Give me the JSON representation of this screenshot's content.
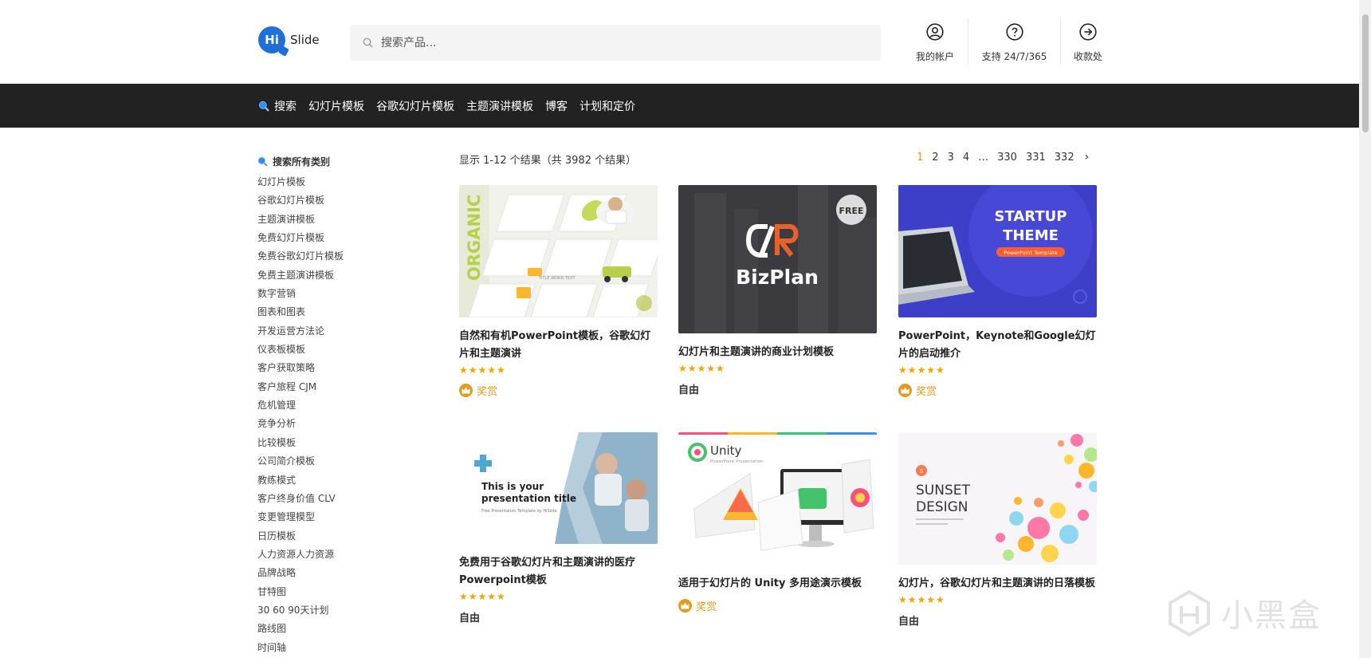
{
  "header": {
    "logo_mark": "Hi",
    "logo_text": "Slide",
    "search_placeholder": "搜索产品...",
    "actions": [
      {
        "label": "我的帐户",
        "icon": "user-circle-icon"
      },
      {
        "label": "支持 24/7/365",
        "icon": "help-circle-icon"
      },
      {
        "label": "收款处",
        "icon": "arrow-circle-right-icon"
      }
    ]
  },
  "nav": {
    "items": [
      "搜索",
      "幻灯片模板",
      "谷歌幻灯片模板",
      "主题演讲模板",
      "博客",
      "计划和定价"
    ]
  },
  "sidebar": {
    "heading": "搜索所有类别",
    "categories": [
      "幻灯片模板",
      "谷歌幻灯片模板",
      "主题演讲模板",
      "免费幻灯片模板",
      "免费谷歌幻灯片模板",
      "免费主题演讲模板",
      "数字营销",
      "图表和图表",
      "开发运营方法论",
      "仪表板模板",
      "客户获取策略",
      "客户旅程 CJM",
      "危机管理",
      "竞争分析",
      "比较模板",
      "公司简介模板",
      "教练模式",
      "客户终身价值 CLV",
      "变更管理模型",
      "日历模板",
      "人力资源人力资源",
      "品牌战略",
      "甘特图",
      "30 60 90天计划",
      "路线图",
      "时间轴"
    ]
  },
  "results": {
    "summary": "显示 1-12 个结果（共 3982 个结果）",
    "pages": [
      "1",
      "2",
      "3",
      "4",
      "…",
      "330",
      "331",
      "332"
    ],
    "current_page": "1",
    "next_label": "›"
  },
  "products": [
    {
      "title": "自然和有机PowerPoint模板，谷歌幻灯片和主题演讲",
      "stars": "★★★★★",
      "badge": "奖赏",
      "badge_type": "award",
      "thumb_text": {
        "main": "ORGANIC",
        "sub": "TITLE WORD TEXT"
      }
    },
    {
      "title": "幻灯片和主题演讲的商业计划模板",
      "stars": "★★★★★",
      "badge": "自由",
      "badge_type": "free",
      "thumb_text": {
        "main": "BizPlan",
        "tag": "FREE"
      }
    },
    {
      "title": "PowerPoint，Keynote和Google幻灯片的启动推介",
      "stars": "★★★★★",
      "badge": "奖赏",
      "badge_type": "award",
      "thumb_text": {
        "main": "STARTUP",
        "main2": "THEME",
        "sub": "PowerPoint Template"
      }
    },
    {
      "title": "免费用于谷歌幻灯片和主题演讲的医疗Powerpoint模板",
      "stars": "★★★★★",
      "badge": "自由",
      "badge_type": "free",
      "thumb_text": {
        "main": "This is your",
        "main2": "presentation title",
        "sub": "Free Presentation Template by HiSlide"
      }
    },
    {
      "title": "适用于幻灯片的 Unity 多用途演示模板",
      "stars": "",
      "badge": "奖赏",
      "badge_type": "award",
      "thumb_text": {
        "main": "Unity",
        "sub": "PowerPoint Presentation"
      }
    },
    {
      "title": "幻灯片，谷歌幻灯片和主题演讲的日落模板",
      "stars": "★★★★★",
      "badge": "自由",
      "badge_type": "free",
      "thumb_text": {
        "main": "SUNSET",
        "main2": "DESIGN",
        "tag": "S"
      }
    }
  ],
  "watermark": "小黑盒",
  "colors": {
    "accent": "#e19b23",
    "nav_bg": "#222222",
    "logo_blue": "#1e6fd9",
    "star": "#f2a400"
  }
}
